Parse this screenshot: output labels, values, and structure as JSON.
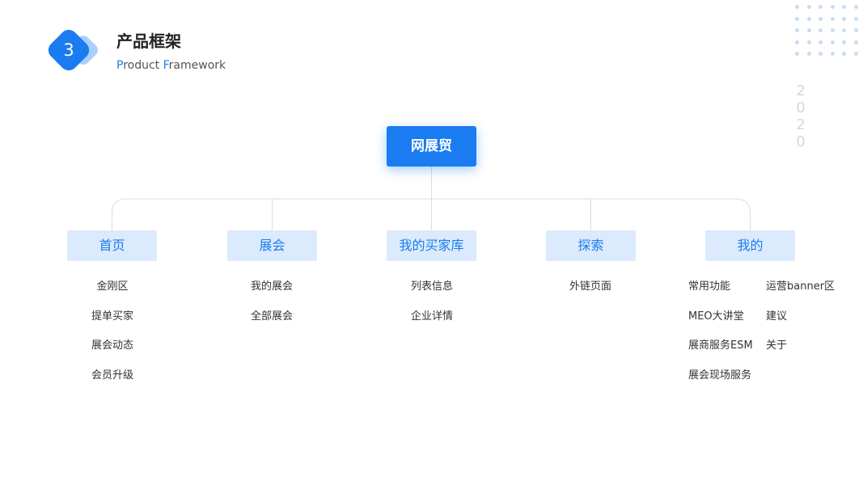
{
  "header": {
    "badge_number": "3",
    "title": "产品框架",
    "subtitle_p_initial": "P",
    "subtitle_p_rest": "roduct ",
    "subtitle_f_initial": "F",
    "subtitle_f_rest": "ramework"
  },
  "year_digits": [
    "2",
    "0",
    "2",
    "0"
  ],
  "root": {
    "label": "网展贸"
  },
  "categories": [
    {
      "label": "首页",
      "items": [
        "金刚区",
        "提单买家",
        "展会动态",
        "会员升级"
      ]
    },
    {
      "label": "展会",
      "items": [
        "我的展会",
        "全部展会"
      ]
    },
    {
      "label": "我的买家库",
      "items": [
        "列表信息",
        "企业详情"
      ]
    },
    {
      "label": "探索",
      "items": [
        "外链页面"
      ]
    },
    {
      "label": "我的",
      "items_col1": [
        "常用功能",
        "MEO大讲堂",
        "展商服务ESM",
        "展会现场服务"
      ],
      "items_col2": [
        "运营banner区",
        "建议",
        "关于"
      ]
    }
  ],
  "colors": {
    "accent": "#1a7cf0",
    "category_bg": "#dbeafc",
    "connector": "#d9dde2"
  }
}
